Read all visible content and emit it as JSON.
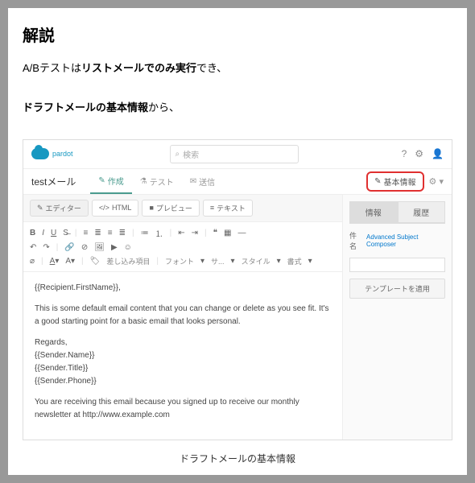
{
  "title": "解説",
  "para1_a": "A/Bテストは",
  "para1_b": "リストメールでのみ実行",
  "para1_c": "でき、",
  "para2_a": "ドラフトメールの",
  "para2_b": "基本情報",
  "para2_c": "から、",
  "app": {
    "brand": "pardot",
    "search_placeholder": "検索",
    "doc_title": "testメール",
    "tabs": {
      "create": "作成",
      "test": "テスト",
      "send": "送信"
    },
    "basic_info": "基本情報",
    "subtabs": {
      "editor": "エディター",
      "html": "HTML",
      "preview": "プレビュー",
      "text": "テキスト"
    },
    "toolbar": {
      "merge": "差し込み項目",
      "font": "フォント",
      "size": "サ...",
      "style": "スタイル",
      "format": "書式"
    },
    "body": {
      "greet": "{{Recipient.FirstName}},",
      "p1": "This is some default email content that you can change or delete as you see fit. It's a good starting point for a basic email that looks personal.",
      "regards": "Regards,",
      "s1": "{{Sender.Name}}",
      "s2": "{{Sender.Title}}",
      "s3": "{{Sender.Phone}}",
      "footer": "You are receiving this email because you signed up to receive our monthly newsletter at http://www.example.com"
    },
    "side": {
      "tab_info": "情報",
      "tab_history": "履歴",
      "subject_label": "件名",
      "subject_link": "Advanced Subject Composer",
      "template_btn": "テンプレートを適用"
    }
  },
  "caption": "ドラフトメールの基本情報"
}
